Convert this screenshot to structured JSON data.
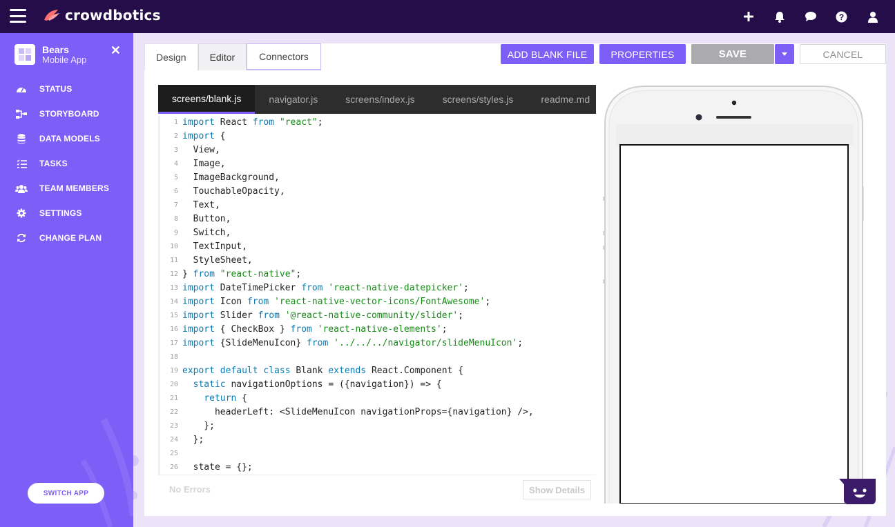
{
  "brand": {
    "name": "crowdbotics"
  },
  "topbar": {
    "icons": [
      "plus-icon",
      "bell-icon",
      "chat-icon",
      "help-icon",
      "user-icon"
    ]
  },
  "sidebar": {
    "app_name": "Bears",
    "app_type": "Mobile App",
    "items": [
      {
        "label": "STATUS",
        "icon": "dashboard-icon"
      },
      {
        "label": "STORYBOARD",
        "icon": "sitemap-icon"
      },
      {
        "label": "DATA MODELS",
        "icon": "database-icon"
      },
      {
        "label": "TASKS",
        "icon": "tasks-icon"
      },
      {
        "label": "TEAM MEMBERS",
        "icon": "users-icon"
      },
      {
        "label": "SETTINGS",
        "icon": "gear-icon"
      },
      {
        "label": "CHANGE PLAN",
        "icon": "refresh-icon"
      }
    ],
    "switch_app": "SWITCH APP"
  },
  "tabs": [
    {
      "label": "Design"
    },
    {
      "label": "Editor",
      "active": true
    },
    {
      "label": "Connectors"
    }
  ],
  "toolbar": {
    "add_blank_file": "ADD BLANK FILE",
    "properties": "PROPERTIES",
    "save": "SAVE",
    "cancel": "CANCEL"
  },
  "editor": {
    "files": [
      "screens/blank.js",
      "navigator.js",
      "screens/index.js",
      "screens/styles.js",
      "readme.md"
    ],
    "active_file": "screens/blank.js",
    "lines": [
      [
        [
          "kw",
          "import"
        ],
        [
          "tx",
          " React "
        ],
        [
          "kw",
          "from"
        ],
        [
          "tx",
          " "
        ],
        [
          "st",
          "\"react\""
        ],
        [
          "tx",
          ";"
        ]
      ],
      [
        [
          "kw",
          "import"
        ],
        [
          "tx",
          " {"
        ]
      ],
      [
        [
          "tx",
          "  View,"
        ]
      ],
      [
        [
          "tx",
          "  Image,"
        ]
      ],
      [
        [
          "tx",
          "  ImageBackground,"
        ]
      ],
      [
        [
          "tx",
          "  TouchableOpacity,"
        ]
      ],
      [
        [
          "tx",
          "  Text,"
        ]
      ],
      [
        [
          "tx",
          "  Button,"
        ]
      ],
      [
        [
          "tx",
          "  Switch,"
        ]
      ],
      [
        [
          "tx",
          "  TextInput,"
        ]
      ],
      [
        [
          "tx",
          "  StyleSheet,"
        ]
      ],
      [
        [
          "tx",
          "} "
        ],
        [
          "kw",
          "from"
        ],
        [
          "tx",
          " "
        ],
        [
          "st",
          "\"react-native\""
        ],
        [
          "tx",
          ";"
        ]
      ],
      [
        [
          "kw",
          "import"
        ],
        [
          "tx",
          " DateTimePicker "
        ],
        [
          "kw",
          "from"
        ],
        [
          "tx",
          " "
        ],
        [
          "st",
          "'react-native-datepicker'"
        ],
        [
          "tx",
          ";"
        ]
      ],
      [
        [
          "kw",
          "import"
        ],
        [
          "tx",
          " Icon "
        ],
        [
          "kw",
          "from"
        ],
        [
          "tx",
          " "
        ],
        [
          "st",
          "'react-native-vector-icons/FontAwesome'"
        ],
        [
          "tx",
          ";"
        ]
      ],
      [
        [
          "kw",
          "import"
        ],
        [
          "tx",
          " Slider "
        ],
        [
          "kw",
          "from"
        ],
        [
          "tx",
          " "
        ],
        [
          "st",
          "'@react-native-community/slider'"
        ],
        [
          "tx",
          ";"
        ]
      ],
      [
        [
          "kw",
          "import"
        ],
        [
          "tx",
          " { CheckBox } "
        ],
        [
          "kw",
          "from"
        ],
        [
          "tx",
          " "
        ],
        [
          "st",
          "'react-native-elements'"
        ],
        [
          "tx",
          ";"
        ]
      ],
      [
        [
          "kw",
          "import"
        ],
        [
          "tx",
          " {SlideMenuIcon} "
        ],
        [
          "kw",
          "from"
        ],
        [
          "tx",
          " "
        ],
        [
          "st",
          "'../../../navigator/slideMenuIcon'"
        ],
        [
          "tx",
          ";"
        ]
      ],
      [
        [
          "tx",
          ""
        ]
      ],
      [
        [
          "kw",
          "export default class"
        ],
        [
          "tx",
          " Blank "
        ],
        [
          "kw",
          "extends"
        ],
        [
          "tx",
          " React.Component {"
        ]
      ],
      [
        [
          "tx",
          "  "
        ],
        [
          "kw",
          "static"
        ],
        [
          "tx",
          " navigationOptions = ({navigation}) => {"
        ]
      ],
      [
        [
          "tx",
          "    "
        ],
        [
          "kw",
          "return"
        ],
        [
          "tx",
          " {"
        ]
      ],
      [
        [
          "tx",
          "      headerLeft: <SlideMenuIcon navigationProps={navigation} />,"
        ]
      ],
      [
        [
          "tx",
          "    };"
        ]
      ],
      [
        [
          "tx",
          "  };"
        ]
      ],
      [
        [
          "tx",
          ""
        ]
      ],
      [
        [
          "tx",
          "  state = {};"
        ]
      ]
    ],
    "status": "No Errors",
    "show_details": "Show Details"
  },
  "colors": {
    "accent": "#7d5ef7",
    "topbar": "#250d4a",
    "save_disabled": "#ababaf"
  }
}
